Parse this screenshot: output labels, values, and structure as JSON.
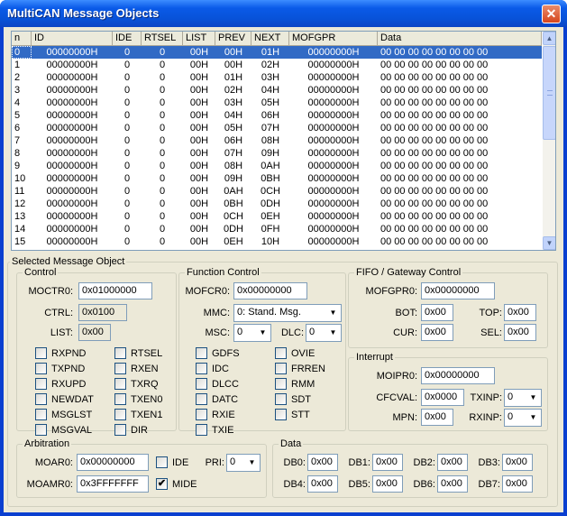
{
  "window": {
    "title": "MultiCAN Message Objects",
    "close_glyph": "✕"
  },
  "list": {
    "columns": [
      {
        "label": "n",
        "w": 22,
        "center": false
      },
      {
        "label": "ID",
        "w": 90,
        "center": true
      },
      {
        "label": "IDE",
        "w": 32,
        "center": true
      },
      {
        "label": "RTSEL",
        "w": 46,
        "center": true
      },
      {
        "label": "LIST",
        "w": 36,
        "center": true
      },
      {
        "label": "PREV",
        "w": 40,
        "center": true
      },
      {
        "label": "NEXT",
        "w": 42,
        "center": true
      },
      {
        "label": "MOFGPR",
        "w": 98,
        "center": true
      },
      {
        "label": "Data",
        "w": 182,
        "center": false
      }
    ],
    "rows": [
      [
        "0",
        "00000000H",
        "0",
        "0",
        "00H",
        "00H",
        "01H",
        "00000000H",
        "00 00 00 00 00 00 00 00"
      ],
      [
        "1",
        "00000000H",
        "0",
        "0",
        "00H",
        "00H",
        "02H",
        "00000000H",
        "00 00 00 00 00 00 00 00"
      ],
      [
        "2",
        "00000000H",
        "0",
        "0",
        "00H",
        "01H",
        "03H",
        "00000000H",
        "00 00 00 00 00 00 00 00"
      ],
      [
        "3",
        "00000000H",
        "0",
        "0",
        "00H",
        "02H",
        "04H",
        "00000000H",
        "00 00 00 00 00 00 00 00"
      ],
      [
        "4",
        "00000000H",
        "0",
        "0",
        "00H",
        "03H",
        "05H",
        "00000000H",
        "00 00 00 00 00 00 00 00"
      ],
      [
        "5",
        "00000000H",
        "0",
        "0",
        "00H",
        "04H",
        "06H",
        "00000000H",
        "00 00 00 00 00 00 00 00"
      ],
      [
        "6",
        "00000000H",
        "0",
        "0",
        "00H",
        "05H",
        "07H",
        "00000000H",
        "00 00 00 00 00 00 00 00"
      ],
      [
        "7",
        "00000000H",
        "0",
        "0",
        "00H",
        "06H",
        "08H",
        "00000000H",
        "00 00 00 00 00 00 00 00"
      ],
      [
        "8",
        "00000000H",
        "0",
        "0",
        "00H",
        "07H",
        "09H",
        "00000000H",
        "00 00 00 00 00 00 00 00"
      ],
      [
        "9",
        "00000000H",
        "0",
        "0",
        "00H",
        "08H",
        "0AH",
        "00000000H",
        "00 00 00 00 00 00 00 00"
      ],
      [
        "10",
        "00000000H",
        "0",
        "0",
        "00H",
        "09H",
        "0BH",
        "00000000H",
        "00 00 00 00 00 00 00 00"
      ],
      [
        "11",
        "00000000H",
        "0",
        "0",
        "00H",
        "0AH",
        "0CH",
        "00000000H",
        "00 00 00 00 00 00 00 00"
      ],
      [
        "12",
        "00000000H",
        "0",
        "0",
        "00H",
        "0BH",
        "0DH",
        "00000000H",
        "00 00 00 00 00 00 00 00"
      ],
      [
        "13",
        "00000000H",
        "0",
        "0",
        "00H",
        "0CH",
        "0EH",
        "00000000H",
        "00 00 00 00 00 00 00 00"
      ],
      [
        "14",
        "00000000H",
        "0",
        "0",
        "00H",
        "0DH",
        "0FH",
        "00000000H",
        "00 00 00 00 00 00 00 00"
      ],
      [
        "15",
        "00000000H",
        "0",
        "0",
        "00H",
        "0EH",
        "10H",
        "00000000H",
        "00 00 00 00 00 00 00 00"
      ]
    ],
    "selected_row": 0,
    "scroll_up_glyph": "▲",
    "scroll_down_glyph": "▼"
  },
  "selected": {
    "title": "Selected Message Object",
    "control": {
      "title": "Control",
      "moctr_label": "MOCTR0:",
      "moctr_value": "0x01000000",
      "ctrl_label": "CTRL:",
      "ctrl_value": "0x0100",
      "list_label": "LIST:",
      "list_value": "0x00",
      "checks_left": [
        {
          "label": "RXPND",
          "checked": false
        },
        {
          "label": "TXPND",
          "checked": false
        },
        {
          "label": "RXUPD",
          "checked": false
        },
        {
          "label": "NEWDAT",
          "checked": false
        },
        {
          "label": "MSGLST",
          "checked": false
        },
        {
          "label": "MSGVAL",
          "checked": false
        }
      ],
      "checks_right": [
        {
          "label": "RTSEL",
          "checked": false
        },
        {
          "label": "RXEN",
          "checked": false
        },
        {
          "label": "TXRQ",
          "checked": false
        },
        {
          "label": "TXEN0",
          "checked": false
        },
        {
          "label": "TXEN1",
          "checked": false
        },
        {
          "label": "DIR",
          "checked": false
        }
      ]
    },
    "function": {
      "title": "Function Control",
      "mofcr_label": "MOFCR0:",
      "mofcr_value": "0x00000000",
      "mmc_label": "MMC:",
      "mmc_value": "0: Stand. Msg.",
      "msc_label": "MSC:",
      "msc_value": "0",
      "dlc_label": "DLC:",
      "dlc_value": "0",
      "checks_left": [
        {
          "label": "GDFS",
          "checked": false
        },
        {
          "label": "IDC",
          "checked": false
        },
        {
          "label": "DLCC",
          "checked": false
        },
        {
          "label": "DATC",
          "checked": false
        },
        {
          "label": "RXIE",
          "checked": false
        },
        {
          "label": "TXIE",
          "checked": false
        }
      ],
      "checks_right": [
        {
          "label": "OVIE",
          "checked": false
        },
        {
          "label": "FRREN",
          "checked": false
        },
        {
          "label": "RMM",
          "checked": false
        },
        {
          "label": "SDT",
          "checked": false
        },
        {
          "label": "STT",
          "checked": false
        }
      ]
    },
    "fifo": {
      "title": "FIFO / Gateway Control",
      "mofgpr_label": "MOFGPR0:",
      "mofgpr_value": "0x00000000",
      "bot_label": "BOT:",
      "bot_value": "0x00",
      "top_label": "TOP:",
      "top_value": "0x00",
      "cur_label": "CUR:",
      "cur_value": "0x00",
      "sel_label": "SEL:",
      "sel_value": "0x00"
    },
    "interrupt": {
      "title": "Interrupt",
      "moipr_label": "MOIPR0:",
      "moipr_value": "0x00000000",
      "cfcval_label": "CFCVAL:",
      "cfcval_value": "0x0000",
      "txinp_label": "TXINP:",
      "txinp_value": "0",
      "mpn_label": "MPN:",
      "mpn_value": "0x00",
      "rxinp_label": "RXINP:",
      "rxinp_value": "0"
    },
    "arbitration": {
      "title": "Arbitration",
      "moar_label": "MOAR0:",
      "moar_value": "0x00000000",
      "ide_label": "IDE",
      "ide_checked": false,
      "pri_label": "PRI:",
      "pri_value": "0",
      "moamr_label": "MOAMR0:",
      "moamr_value": "0x3FFFFFFF",
      "mide_label": "MIDE",
      "mide_checked": true
    },
    "data": {
      "title": "Data",
      "bytes": [
        {
          "label": "DB0:",
          "value": "0x00"
        },
        {
          "label": "DB1:",
          "value": "0x00"
        },
        {
          "label": "DB2:",
          "value": "0x00"
        },
        {
          "label": "DB3:",
          "value": "0x00"
        },
        {
          "label": "DB4:",
          "value": "0x00"
        },
        {
          "label": "DB5:",
          "value": "0x00"
        },
        {
          "label": "DB6:",
          "value": "0x00"
        },
        {
          "label": "DB7:",
          "value": "0x00"
        }
      ]
    }
  },
  "glyphs": {
    "check": "✔",
    "dropdown": "▼"
  }
}
